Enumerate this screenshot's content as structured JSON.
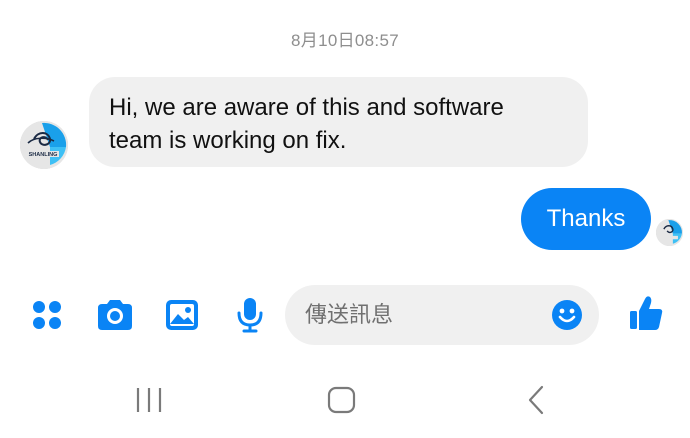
{
  "conversation": {
    "timestamp": "8月10日08:57",
    "messages": [
      {
        "direction": "incoming",
        "text": "Hi, we are aware of this and software team is working on fix.",
        "lines": [
          "Hi, we are aware of this and software",
          "team is working on fix."
        ]
      },
      {
        "direction": "outgoing",
        "text": "Thanks"
      }
    ],
    "avatar_text": "SHANLING"
  },
  "composer": {
    "placeholder": "傳送訊息"
  },
  "toolbar": {
    "icons": [
      "apps-icon",
      "camera-icon",
      "gallery-icon",
      "microphone-icon",
      "emoji-icon",
      "like-icon"
    ]
  },
  "navbar": {
    "icons": [
      "recent-apps-icon",
      "home-icon",
      "back-icon"
    ]
  },
  "colors": {
    "accent": "#0a84f5",
    "incoming_bubble": "#f0f0f0",
    "timestamp": "#8e8e8e",
    "nav_icons": "#7a7a7a"
  }
}
